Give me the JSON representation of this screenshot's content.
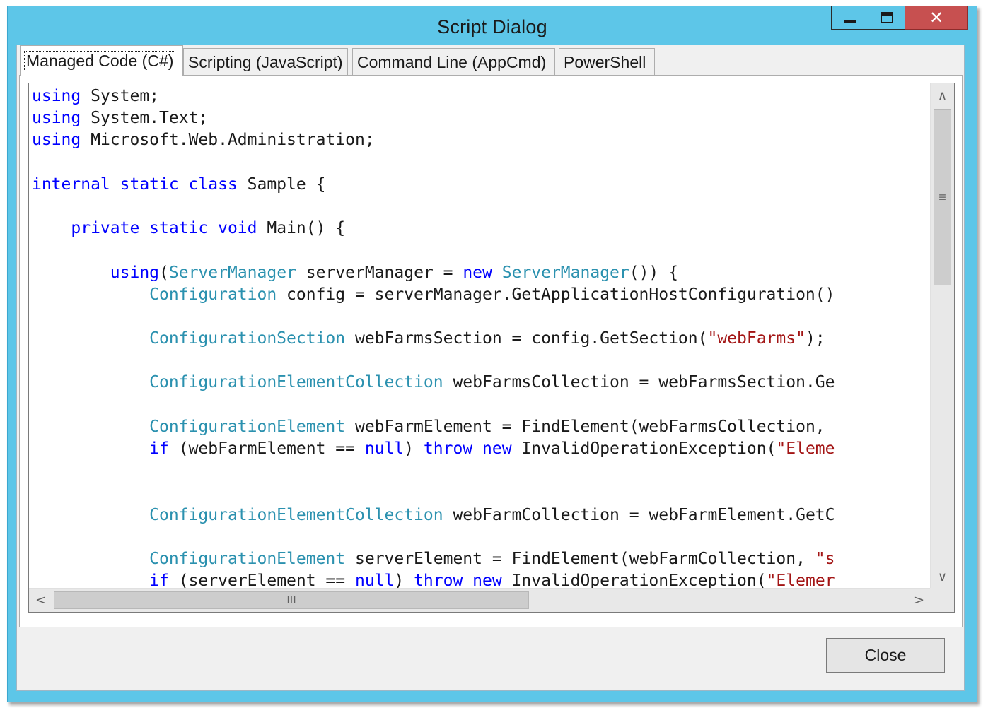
{
  "window": {
    "title": "Script Dialog",
    "controls": {
      "minimize": "minimize",
      "maximize": "maximize",
      "close": "✕"
    }
  },
  "tabs": [
    {
      "label": "Managed Code (C#)",
      "active": true
    },
    {
      "label": "Scripting (JavaScript)",
      "active": false
    },
    {
      "label": "Command Line (AppCmd)",
      "active": false
    },
    {
      "label": "PowerShell",
      "active": false
    }
  ],
  "code_colors": {
    "keyword": "#0000ff",
    "type": "#2b91af",
    "string": "#a31515",
    "plain": "#1a1a1a"
  },
  "code_lines": [
    [
      {
        "t": "kw",
        "v": "using"
      },
      {
        "t": "pl",
        "v": " System;"
      }
    ],
    [
      {
        "t": "kw",
        "v": "using"
      },
      {
        "t": "pl",
        "v": " System.Text;"
      }
    ],
    [
      {
        "t": "kw",
        "v": "using"
      },
      {
        "t": "pl",
        "v": " Microsoft.Web.Administration;"
      }
    ],
    [],
    [
      {
        "t": "kw",
        "v": "internal static class"
      },
      {
        "t": "pl",
        "v": " Sample {"
      }
    ],
    [],
    [
      {
        "t": "pl",
        "v": "    "
      },
      {
        "t": "kw",
        "v": "private static void"
      },
      {
        "t": "pl",
        "v": " Main() {"
      }
    ],
    [],
    [
      {
        "t": "pl",
        "v": "        "
      },
      {
        "t": "kw",
        "v": "using"
      },
      {
        "t": "pl",
        "v": "("
      },
      {
        "t": "ty",
        "v": "ServerManager"
      },
      {
        "t": "pl",
        "v": " serverManager = "
      },
      {
        "t": "kw",
        "v": "new"
      },
      {
        "t": "pl",
        "v": " "
      },
      {
        "t": "ty",
        "v": "ServerManager"
      },
      {
        "t": "pl",
        "v": "()) {"
      }
    ],
    [
      {
        "t": "pl",
        "v": "            "
      },
      {
        "t": "ty",
        "v": "Configuration"
      },
      {
        "t": "pl",
        "v": " config = serverManager.GetApplicationHostConfiguration()"
      }
    ],
    [],
    [
      {
        "t": "pl",
        "v": "            "
      },
      {
        "t": "ty",
        "v": "ConfigurationSection"
      },
      {
        "t": "pl",
        "v": " webFarmsSection = config.GetSection("
      },
      {
        "t": "st",
        "v": "\"webFarms\""
      },
      {
        "t": "pl",
        "v": ");"
      }
    ],
    [],
    [
      {
        "t": "pl",
        "v": "            "
      },
      {
        "t": "ty",
        "v": "ConfigurationElementCollection"
      },
      {
        "t": "pl",
        "v": " webFarmsCollection = webFarmsSection.Ge"
      }
    ],
    [],
    [
      {
        "t": "pl",
        "v": "            "
      },
      {
        "t": "ty",
        "v": "ConfigurationElement"
      },
      {
        "t": "pl",
        "v": " webFarmElement = FindElement(webFarmsCollection,"
      }
    ],
    [
      {
        "t": "pl",
        "v": "            "
      },
      {
        "t": "kw",
        "v": "if"
      },
      {
        "t": "pl",
        "v": " (webFarmElement == "
      },
      {
        "t": "kw",
        "v": "null"
      },
      {
        "t": "pl",
        "v": ") "
      },
      {
        "t": "kw",
        "v": "throw new"
      },
      {
        "t": "pl",
        "v": " InvalidOperationException("
      },
      {
        "t": "st",
        "v": "\"Eleme"
      }
    ],
    [],
    [],
    [
      {
        "t": "pl",
        "v": "            "
      },
      {
        "t": "ty",
        "v": "ConfigurationElementCollection"
      },
      {
        "t": "pl",
        "v": " webFarmCollection = webFarmElement.GetC"
      }
    ],
    [],
    [
      {
        "t": "pl",
        "v": "            "
      },
      {
        "t": "ty",
        "v": "ConfigurationElement"
      },
      {
        "t": "pl",
        "v": " serverElement = FindElement(webFarmCollection, "
      },
      {
        "t": "st",
        "v": "\"s"
      }
    ],
    [
      {
        "t": "pl",
        "v": "            "
      },
      {
        "t": "kw",
        "v": "if"
      },
      {
        "t": "pl",
        "v": " (serverElement == "
      },
      {
        "t": "kw",
        "v": "null"
      },
      {
        "t": "pl",
        "v": ") "
      },
      {
        "t": "kw",
        "v": "throw new"
      },
      {
        "t": "pl",
        "v": " InvalidOperationException("
      },
      {
        "t": "st",
        "v": "\"Elemer"
      }
    ]
  ],
  "scrollbars": {
    "up": "∧",
    "down": "∨",
    "left": "<",
    "right": ">",
    "v_grip": "≡",
    "h_grip": "III"
  },
  "footer": {
    "close_label": "Close"
  }
}
